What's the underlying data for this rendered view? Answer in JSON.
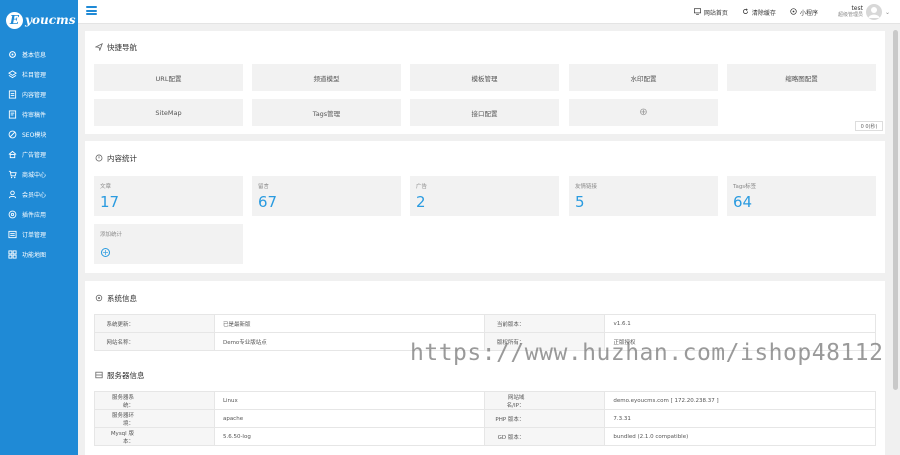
{
  "brand": {
    "logo_mark": "E",
    "logo_text": "youcms"
  },
  "sidebar": {
    "items": [
      {
        "label": "基本信息",
        "icon": "gear-icon"
      },
      {
        "label": "栏目管理",
        "icon": "layers-icon"
      },
      {
        "label": "内容管理",
        "icon": "document-icon"
      },
      {
        "label": "待审稿件",
        "icon": "pending-doc-icon"
      },
      {
        "label": "SEO模块",
        "icon": "seo-icon"
      },
      {
        "label": "广告管理",
        "icon": "ad-icon"
      },
      {
        "label": "商城中心",
        "icon": "cart-icon"
      },
      {
        "label": "会员中心",
        "icon": "user-icon"
      },
      {
        "label": "插件应用",
        "icon": "plugin-icon"
      },
      {
        "label": "订单管理",
        "icon": "order-icon"
      },
      {
        "label": "功能地图",
        "icon": "grid-icon"
      }
    ]
  },
  "topbar": {
    "links": [
      {
        "label": "网站首页",
        "icon": "monitor-icon"
      },
      {
        "label": "清除缓存",
        "icon": "refresh-icon"
      },
      {
        "label": "小程序",
        "icon": "mini-program-icon"
      }
    ],
    "user": {
      "name": "test",
      "role": "超级管理员"
    }
  },
  "quick_nav": {
    "title": "快捷导航",
    "items": [
      "URL配置",
      "频道模型",
      "模板管理",
      "水印配置",
      "缩略图配置",
      "SiteMap",
      "Tags管理",
      "接口配置"
    ],
    "add_symbol": "⊕",
    "timer": "0 0(秒)"
  },
  "content_stats": {
    "title": "内容统计",
    "items": [
      {
        "label": "文章",
        "value": "17"
      },
      {
        "label": "留言",
        "value": "67"
      },
      {
        "label": "广告",
        "value": "2"
      },
      {
        "label": "友情链接",
        "value": "5"
      },
      {
        "label": "Tags标签",
        "value": "64"
      }
    ],
    "add_label": "添加统计",
    "add_symbol": "+"
  },
  "system_info": {
    "title": "系统信息",
    "rows": [
      {
        "k1": "系统更新：",
        "v1": "已是最新版",
        "k2": "当前版本：",
        "v2": "v1.6.1"
      },
      {
        "k1": "网站名称：",
        "v1": "Demo专业版站点",
        "k2": "版权所有：",
        "v2": "正版授权"
      }
    ]
  },
  "server_info": {
    "title": "服务器信息",
    "rows": [
      {
        "k1": "服务器系统：",
        "v1": "Linux",
        "k2": "网站域名/IP：",
        "v2": "demo.eyoucms.com [ 172.20.238.37 ]"
      },
      {
        "k1": "服务器环境：",
        "v1": "apache",
        "k2": "PHP 版本：",
        "v2": "7.3.31"
      },
      {
        "k1": "Mysql 版本：",
        "v1": "5.6.50-log",
        "k2": "GD 版本：",
        "v2": "bundled (2.1.0 compatible)"
      }
    ]
  },
  "watermark": "https://www.huzhan.com/ishop48112",
  "colors": {
    "sidebar": "#1f8ad6",
    "accent": "#2a9be0",
    "background": "#f0f0f0"
  }
}
